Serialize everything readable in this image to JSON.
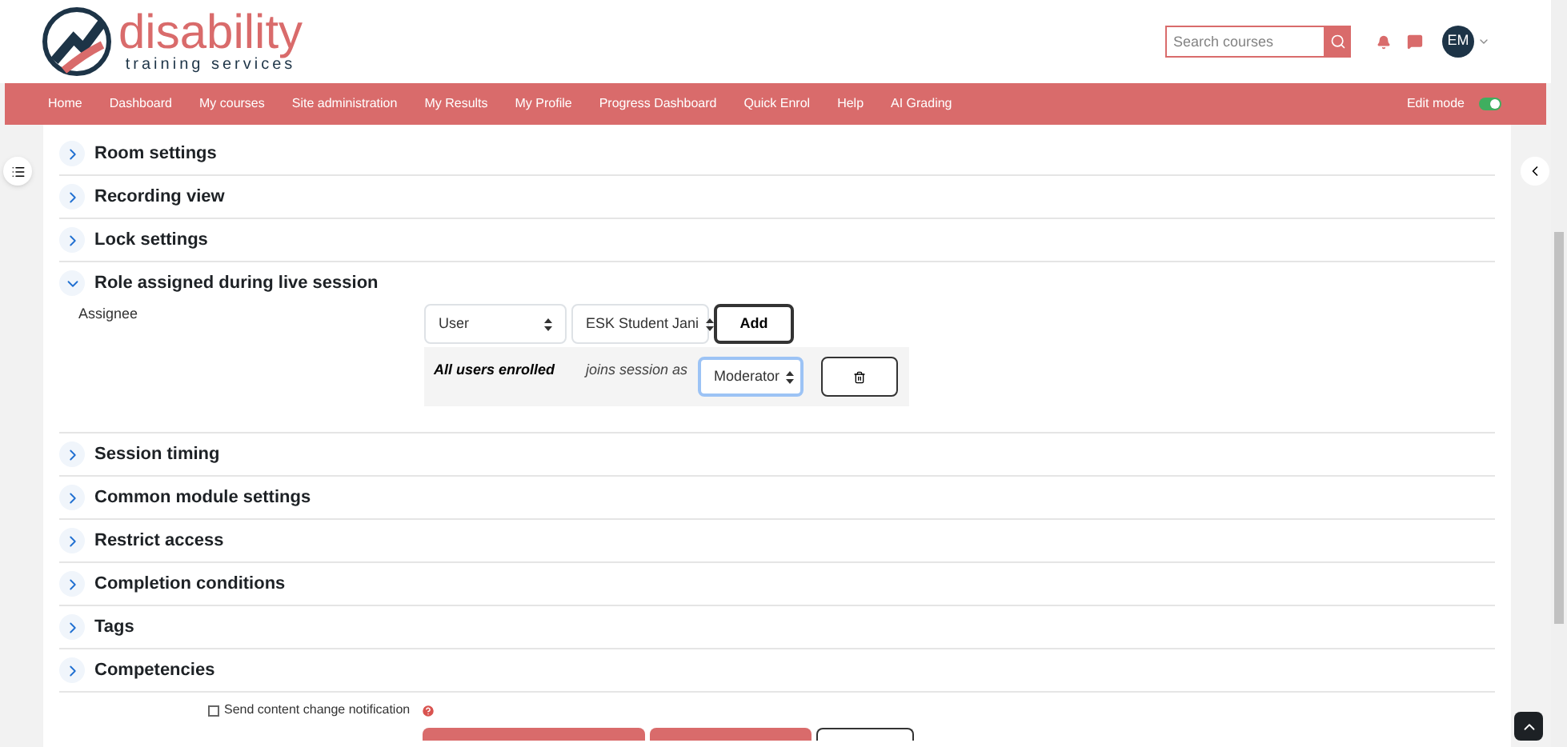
{
  "header": {
    "logo_title": "disability",
    "logo_subtitle": "training services",
    "search": {
      "placeholder": "Search courses"
    },
    "avatar": "EM"
  },
  "nav": {
    "items": [
      "Home",
      "Dashboard",
      "My courses",
      "Site administration",
      "My Results",
      "My Profile",
      "Progress Dashboard",
      "Quick Enrol",
      "Help",
      "AI Grading"
    ],
    "edit_mode": {
      "label": "Edit mode",
      "on": true
    }
  },
  "sections": [
    {
      "title": "Room settings",
      "expanded": false
    },
    {
      "title": "Recording view",
      "expanded": false
    },
    {
      "title": "Lock settings",
      "expanded": false
    },
    {
      "title": "Role assigned during live session",
      "expanded": true,
      "assignee": {
        "label": "Assignee",
        "type_select": "User",
        "user_select": "ESK Student Jani",
        "add_button": "Add",
        "rows": [
          {
            "who": "All users enrolled",
            "joins": "joins session as",
            "role": "Moderator"
          }
        ]
      }
    },
    {
      "title": "Session timing",
      "expanded": false
    },
    {
      "title": "Common module settings",
      "expanded": false
    },
    {
      "title": "Restrict access",
      "expanded": false
    },
    {
      "title": "Completion conditions",
      "expanded": false
    },
    {
      "title": "Tags",
      "expanded": false
    },
    {
      "title": "Competencies",
      "expanded": false
    }
  ],
  "notification": {
    "label": "Send content change notification",
    "checked": false
  }
}
